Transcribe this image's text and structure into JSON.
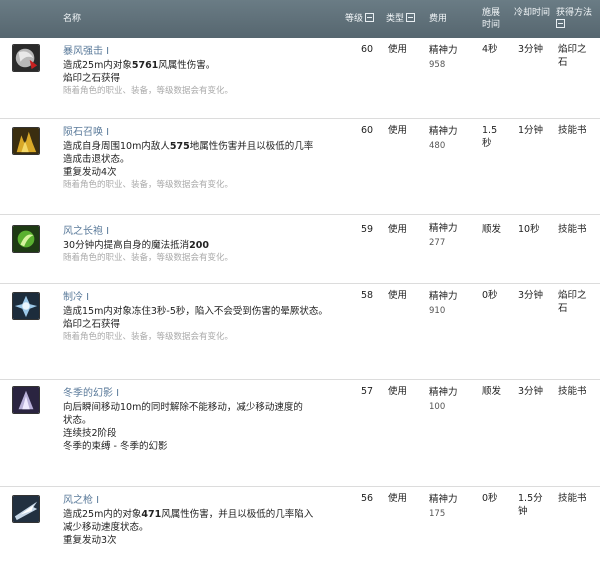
{
  "header": {
    "name": "名称",
    "level": "等级",
    "type": "类型",
    "cost": "费用",
    "cast_line1": "施展",
    "cast_line2": "时间",
    "cooldown": "冷却时间",
    "acquire": "获得方法"
  },
  "skills": [
    {
      "name": "暴风强击 Ⅰ",
      "desc_pre": "造成25m内对象",
      "desc_num": "5761",
      "desc_post": "风属性伤害。",
      "desc_line2": "",
      "extra": [
        "焰印之石获得"
      ],
      "note": "随着角色的职业、装备，等级数据会有变化。",
      "level": "60",
      "type": "使用",
      "cost": "精神力",
      "cost_val": "958",
      "cast": [
        "4秒"
      ],
      "cooldown": [
        "3分钟"
      ],
      "acquire": [
        "焰印之",
        "石"
      ]
    },
    {
      "name": "陨石召唤 Ⅰ",
      "desc_pre": "造成自身周围10m内敌人",
      "desc_num": "575",
      "desc_post": "地属性伤害并且以极低的几率",
      "desc_line2": "造成击退状态。",
      "extra": [
        "重复发动4次"
      ],
      "note": "随着角色的职业、装备，等级数据会有变化。",
      "level": "60",
      "type": "使用",
      "cost": "精神力",
      "cost_val": "480",
      "cast": [
        "1.5",
        "秒"
      ],
      "cooldown": [
        "1分钟"
      ],
      "acquire": [
        "技能书"
      ]
    },
    {
      "name": "风之长袍 Ⅰ",
      "desc_pre": "30分钟内提高自身的魔法抵消",
      "desc_num": "200",
      "desc_post": "",
      "desc_line2": "",
      "extra": [],
      "note": "随着角色的职业、装备，等级数据会有变化。",
      "level": "59",
      "type": "使用",
      "cost": "精神力",
      "cost_val": "277",
      "cast": [
        "顺发"
      ],
      "cooldown": [
        "10秒"
      ],
      "acquire": [
        "技能书"
      ]
    },
    {
      "name": "制冷 Ⅰ",
      "desc_pre": "造成15m内对象冻住3秒-5秒，陷入不会受到伤害的晕厥状态。",
      "desc_num": "",
      "desc_post": "",
      "desc_line2": "",
      "extra": [
        "焰印之石获得"
      ],
      "note": "随着角色的职业、装备，等级数据会有变化。",
      "level": "58",
      "type": "使用",
      "cost": "精神力",
      "cost_val": "910",
      "cast": [
        "0秒"
      ],
      "cooldown": [
        "3分钟"
      ],
      "acquire": [
        "焰印之",
        "石"
      ]
    },
    {
      "name": "冬季的幻影 Ⅰ",
      "desc_pre": "向后瞬间移动10m的同时解除不能移动，减少移动速度的",
      "desc_num": "",
      "desc_post": "",
      "desc_line2": "状态。",
      "extra": [
        "连续技2阶段",
        "冬季的束缚 - 冬季的幻影"
      ],
      "note": "",
      "level": "57",
      "type": "使用",
      "cost": "精神力",
      "cost_val": "100",
      "cast": [
        "顺发"
      ],
      "cooldown": [
        "3分钟"
      ],
      "acquire": [
        "技能书"
      ]
    },
    {
      "name": "风之枪 Ⅰ",
      "desc_pre": "造成25m内的对象",
      "desc_num": "471",
      "desc_post": "风属性伤害，并且以极低的几率陷入",
      "desc_line2": "减少移动速度状态。",
      "extra": [
        "重复发动3次"
      ],
      "note": "",
      "level": "56",
      "type": "使用",
      "cost": "精神力",
      "cost_val": "175",
      "cast": [
        "0秒"
      ],
      "cooldown": [
        "1.5分",
        "钟"
      ],
      "acquire": [
        "技能书"
      ]
    }
  ],
  "icons": [
    "storm-strike-icon",
    "meteor-summon-icon",
    "wind-robe-icon",
    "freeze-icon",
    "winter-phantom-icon",
    "wind-spear-icon"
  ],
  "colors": {
    "header_bg": "#5e6f78",
    "name_text": "#5a7a9a",
    "note_text": "#aaaaaa"
  }
}
